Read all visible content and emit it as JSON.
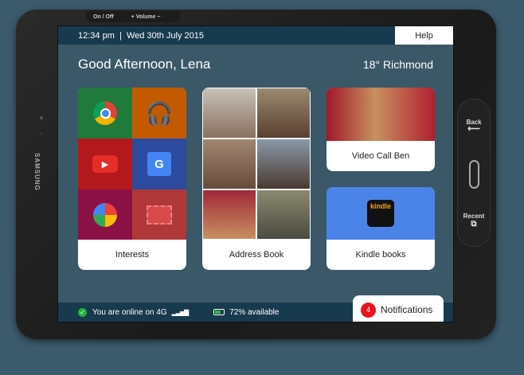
{
  "device": {
    "brand": "SAMSUNG",
    "hw_power": "On / Off",
    "hw_volume": "+  Volume  −",
    "nav_back": "Back",
    "nav_recent": "Recent"
  },
  "topbar": {
    "datetime": "12:34 pm  |  Wed 30th July 2015",
    "help": "Help"
  },
  "greeting": "Good Afternoon, Lena",
  "weather": "18° Richmond",
  "tiles": {
    "interests": "Interests",
    "address_book": "Address Book",
    "video_call": "Video Call Ben",
    "kindle": "Kindle books",
    "kindle_logo": "kindle"
  },
  "status": {
    "online": "You are online on 4G",
    "battery": "72% available"
  },
  "notifications": {
    "count": "4",
    "label": "Notifications"
  },
  "colors": {
    "screen": "#3a5868",
    "bar": "#183a4e",
    "kindle_blue": "#4a84e8",
    "badge": "#e8141c"
  }
}
